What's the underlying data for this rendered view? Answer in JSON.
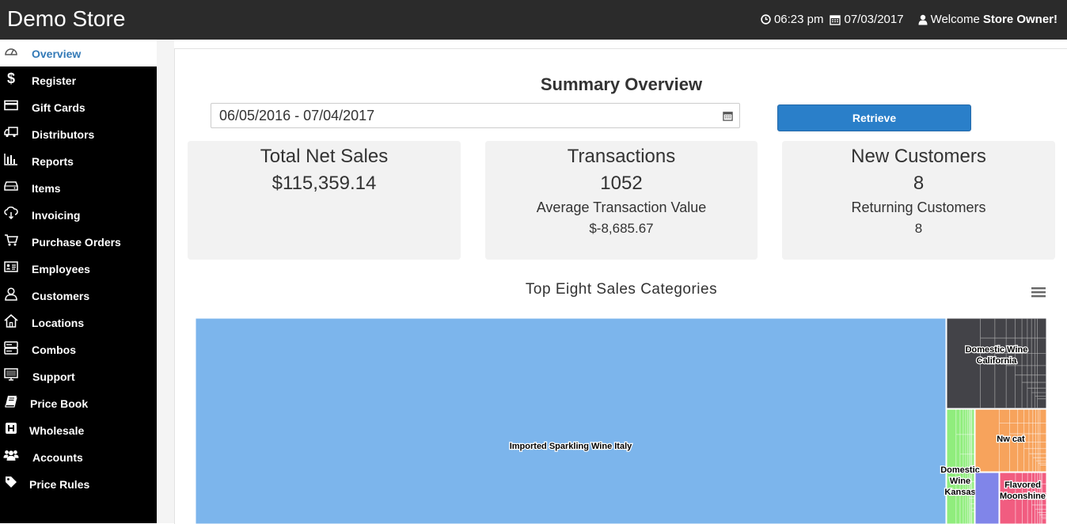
{
  "header": {
    "store_name": "Demo Store",
    "time": "06:23 pm",
    "date": "07/03/2017",
    "welcome": "Welcome",
    "user": "Store Owner!"
  },
  "sidebar": {
    "items": [
      {
        "label": "Overview",
        "icon": "dashboard-gauge-icon",
        "active": true
      },
      {
        "label": "Register",
        "icon": "dollar-icon"
      },
      {
        "label": "Gift Cards",
        "icon": "credit-card-icon"
      },
      {
        "label": "Distributors",
        "icon": "truck-icon"
      },
      {
        "label": "Reports",
        "icon": "bar-chart-icon"
      },
      {
        "label": "Items",
        "icon": "drive-icon"
      },
      {
        "label": "Invoicing",
        "icon": "cloud-download-icon"
      },
      {
        "label": "Purchase Orders",
        "icon": "shopping-cart-icon"
      },
      {
        "label": "Employees",
        "icon": "id-card-icon"
      },
      {
        "label": "Customers",
        "icon": "user-icon"
      },
      {
        "label": "Locations",
        "icon": "home-icon"
      },
      {
        "label": "Combos",
        "icon": "server-icon"
      },
      {
        "label": "Support",
        "icon": "monitor-icon"
      },
      {
        "label": "Price Book",
        "icon": "book-icon"
      },
      {
        "label": "Wholesale",
        "icon": "hospital-h-icon"
      },
      {
        "label": "Accounts",
        "icon": "users-icon"
      },
      {
        "label": "Price Rules",
        "icon": "tag-icon"
      }
    ]
  },
  "main": {
    "title": "Summary Overview",
    "date_range": "06/05/2016 - 07/04/2017",
    "retrieve_label": "Retrieve",
    "cards": {
      "net_sales": {
        "title": "Total Net Sales",
        "value": "$115,359.14"
      },
      "transactions": {
        "title": "Transactions",
        "value": "1052",
        "sub_label": "Average Transaction Value",
        "sub_value": "$-8,685.67"
      },
      "new_customers": {
        "title": "New Customers",
        "value": "8",
        "sub_label": "Returning Customers",
        "sub_value": "8"
      }
    }
  },
  "chart_data": {
    "type": "treemap",
    "title": "Top Eight Sales Categories",
    "categories": [
      {
        "name": "Imported Sparkling Wine Italy",
        "color": "#7cb5ec"
      },
      {
        "name": "Domestic Wine California",
        "color": "#434348"
      },
      {
        "name": "Nw cat",
        "color": "#f7a35c"
      },
      {
        "name": "Domestic Wine Kansas",
        "color": "#90ed7d"
      },
      {
        "name": "",
        "color": "#8085e9"
      },
      {
        "name": "Flavored Moonshine",
        "color": "#f15c80"
      }
    ]
  },
  "colors": {
    "header_bg": "#2b2b2b",
    "sidebar_bg": "#000000",
    "accent": "#337ab7",
    "button": "#2a7fc9"
  }
}
